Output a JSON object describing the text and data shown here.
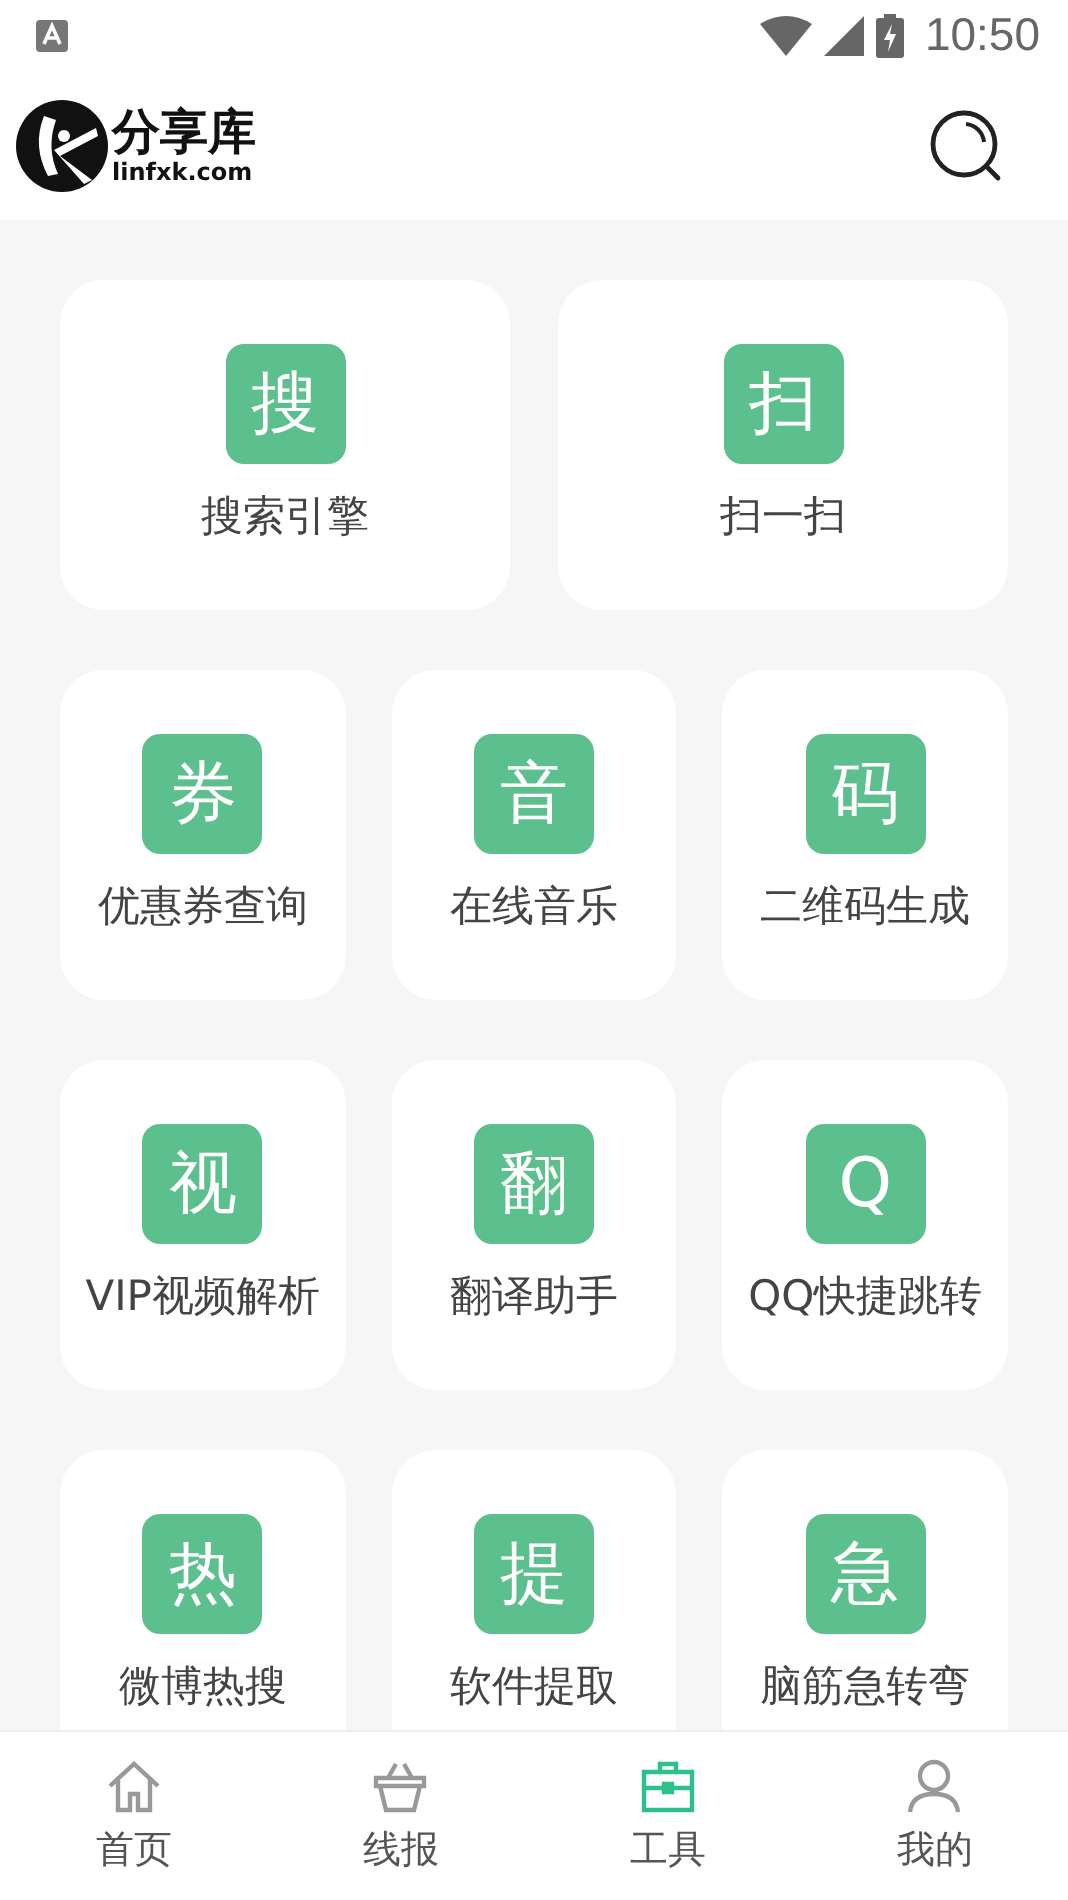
{
  "status_bar": {
    "time": "10:50"
  },
  "header": {
    "logo_title": "分享库",
    "logo_subtitle": "linfxk.com"
  },
  "featured_tools": [
    {
      "icon_char": "搜",
      "label": "搜索引擎"
    },
    {
      "icon_char": "扫",
      "label": "扫一扫"
    }
  ],
  "tools": [
    {
      "icon_char": "券",
      "label": "优惠券查询"
    },
    {
      "icon_char": "音",
      "label": "在线音乐"
    },
    {
      "icon_char": "码",
      "label": "二维码生成"
    },
    {
      "icon_char": "视",
      "label": "VIP视频解析"
    },
    {
      "icon_char": "翻",
      "label": "翻译助手"
    },
    {
      "icon_char": "Q",
      "label": "QQ快捷跳转"
    },
    {
      "icon_char": "热",
      "label": "微博热搜"
    },
    {
      "icon_char": "提",
      "label": "软件提取"
    },
    {
      "icon_char": "急",
      "label": "脑筋急转弯"
    }
  ],
  "bottom_nav": [
    {
      "kind": "home",
      "label": "首页",
      "selected": false
    },
    {
      "kind": "basket",
      "label": "线报",
      "selected": false
    },
    {
      "kind": "toolbox",
      "label": "工具",
      "selected": true
    },
    {
      "kind": "person",
      "label": "我的",
      "selected": false
    }
  ]
}
